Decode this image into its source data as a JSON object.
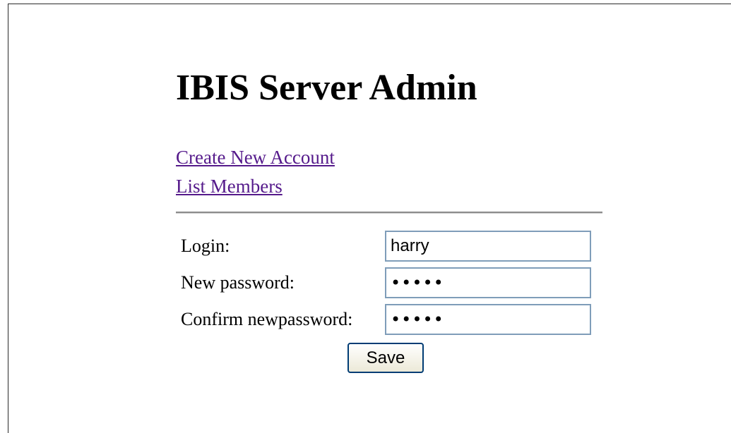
{
  "header": {
    "title": "IBIS Server Admin"
  },
  "nav": {
    "links": [
      {
        "label": "Create New Account"
      },
      {
        "label": "List Members"
      }
    ]
  },
  "form": {
    "login": {
      "label": "Login:",
      "value": "harry"
    },
    "new_password": {
      "label": "New password:",
      "value": "•••••"
    },
    "confirm_password": {
      "label": "Confirm newpassword:",
      "value": "•••••"
    },
    "save_label": "Save"
  },
  "colors": {
    "link": "#551a8b",
    "input_border": "#7f9db9",
    "button_border": "#003c74",
    "divider": "#8c8c8c"
  }
}
